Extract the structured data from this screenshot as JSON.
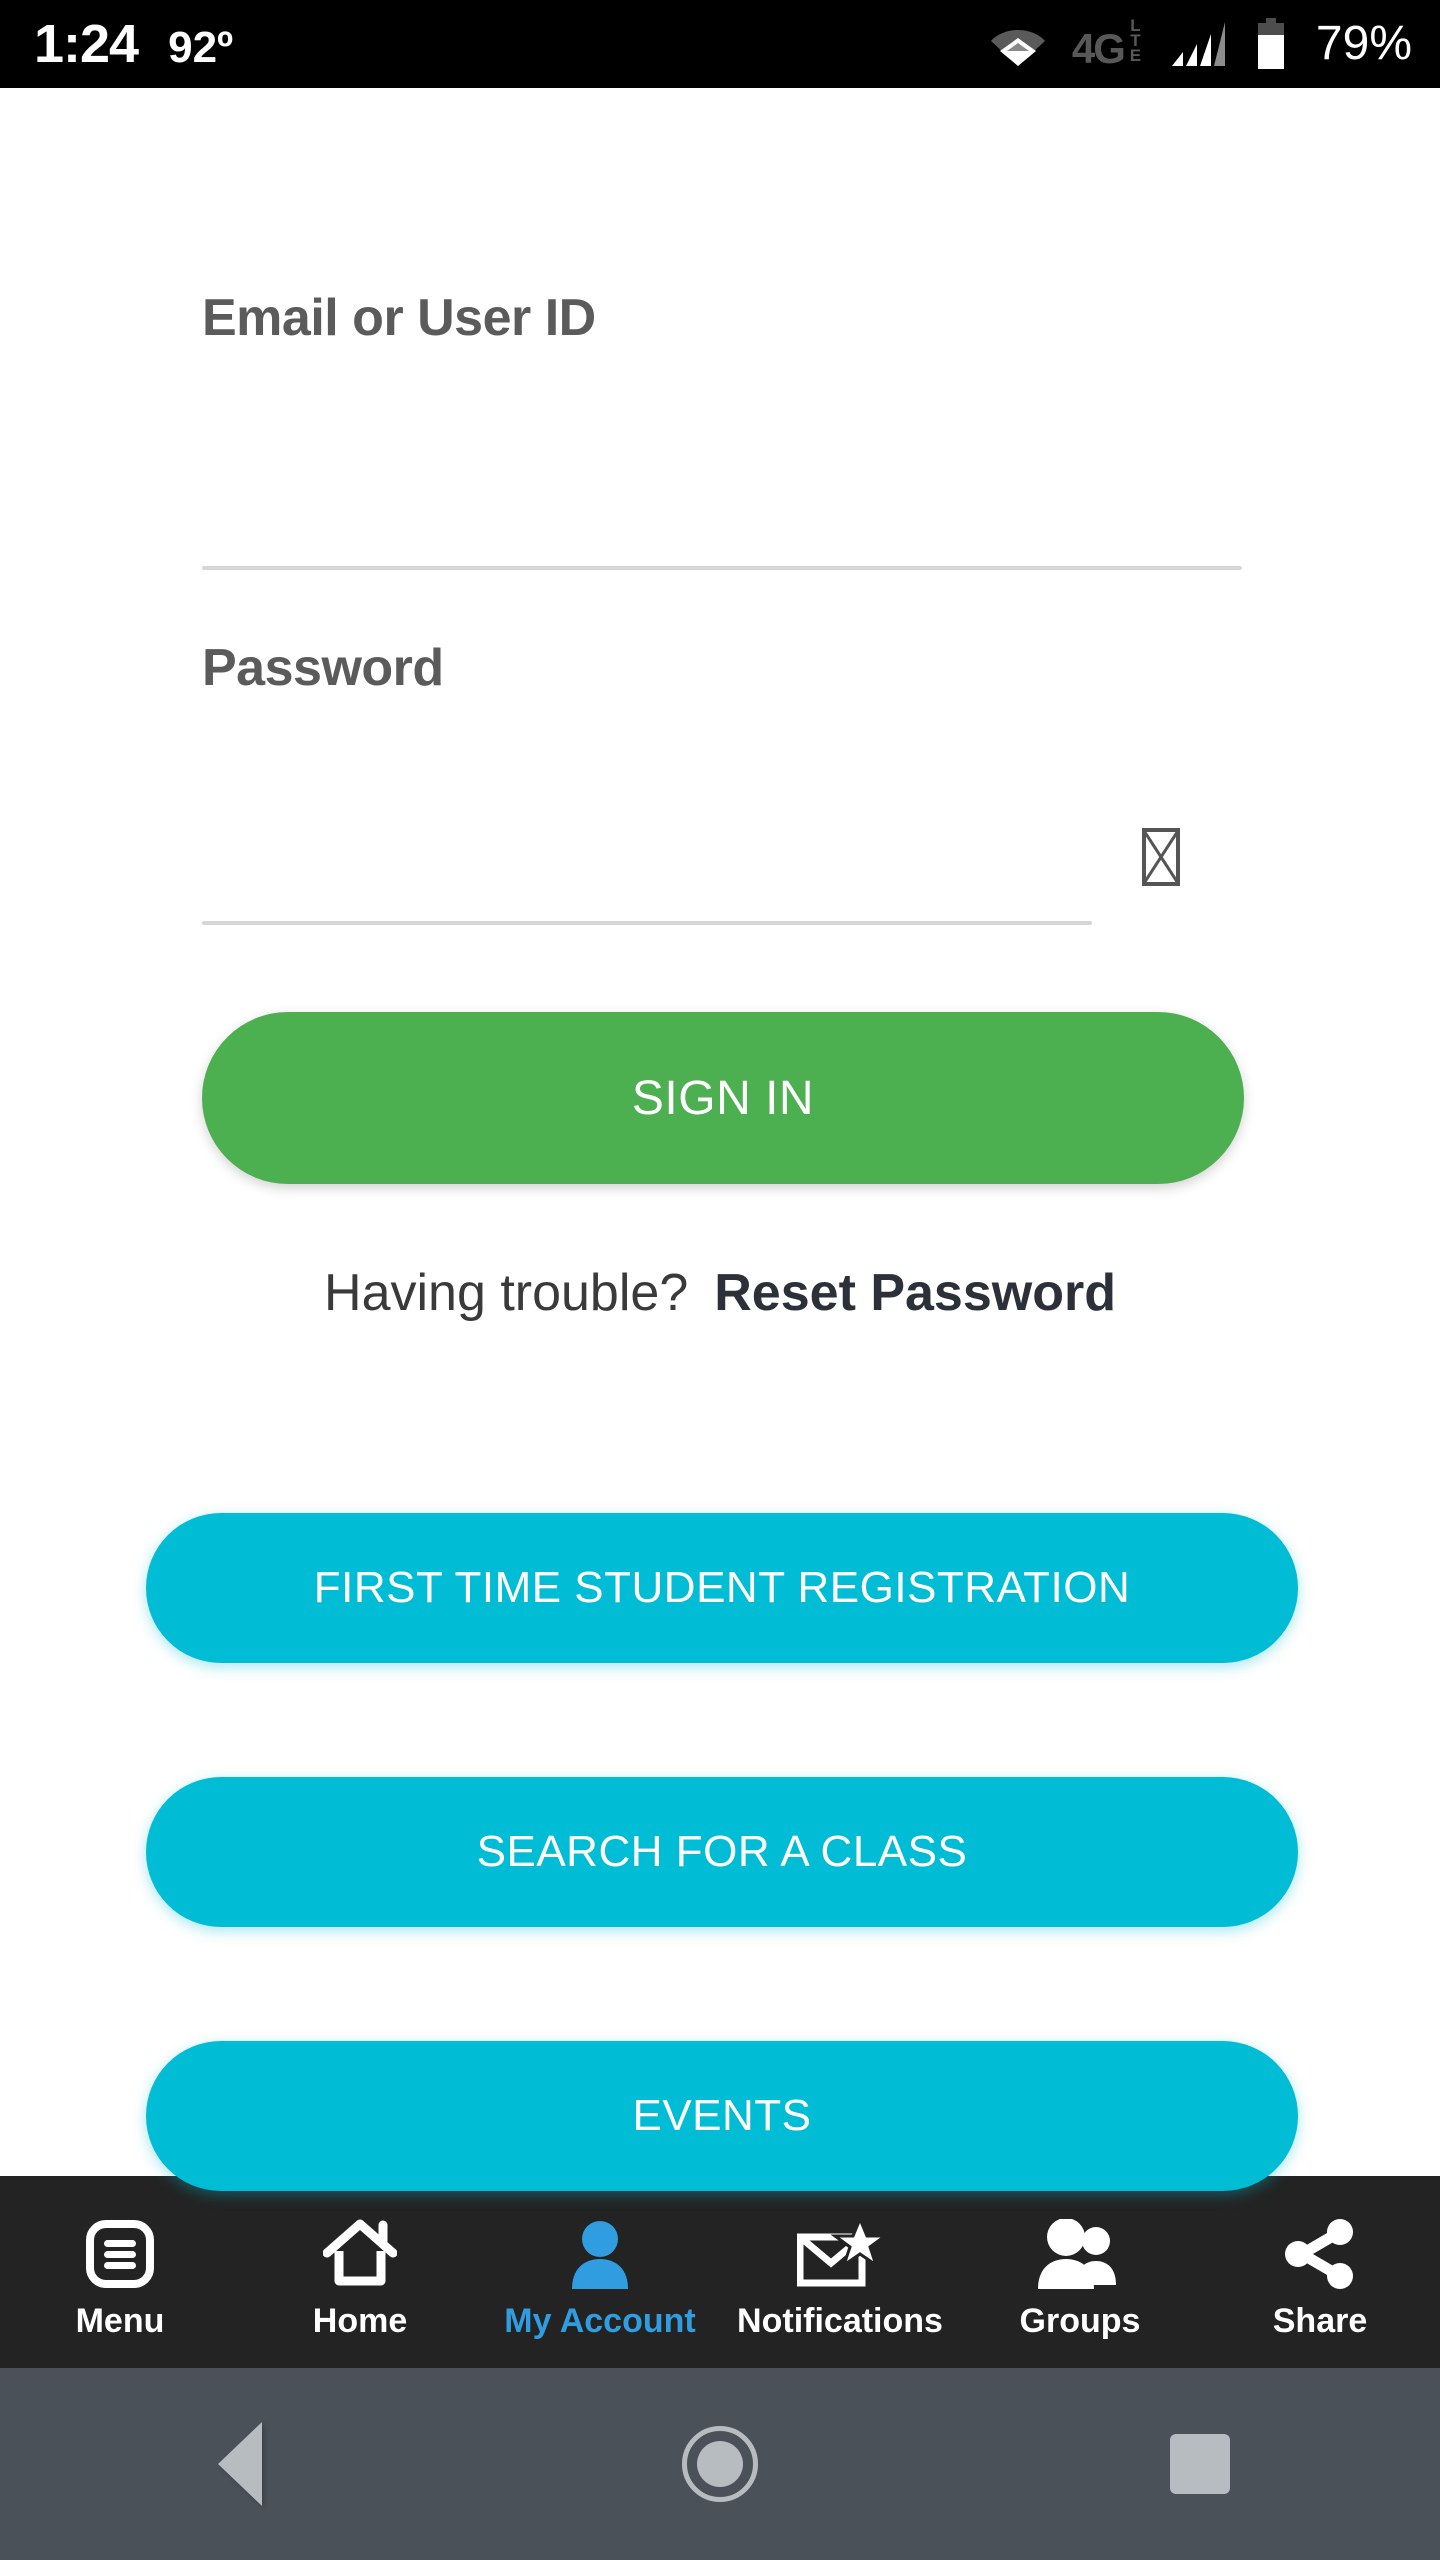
{
  "status_bar": {
    "time": "1:24",
    "temperature": "92º",
    "network_type": "4G",
    "network_sub": "LTE",
    "battery_percent": "79%",
    "wifi_icon": "wifi-icon",
    "signal_icon": "cellular-signal-icon",
    "battery_icon": "battery-icon"
  },
  "login_form": {
    "email_label": "Email or User ID",
    "email_value": "",
    "email_placeholder": "",
    "password_label": "Password",
    "password_value": "",
    "password_placeholder": "",
    "password_toggle_icon": "missing-glyph-box",
    "sign_in_label": "SIGN IN",
    "sign_in_color": "#4CAF50",
    "trouble_text": "Having trouble?",
    "reset_password_label": "Reset Password"
  },
  "actions": {
    "accent_color": "#00BCD4",
    "buttons": [
      {
        "label": "FIRST TIME STUDENT REGISTRATION",
        "name": "first-time-student-registration-button"
      },
      {
        "label": "SEARCH FOR A CLASS",
        "name": "search-for-a-class-button"
      },
      {
        "label": "EVENTS",
        "name": "events-button"
      }
    ]
  },
  "tabbar": {
    "active_color": "#2F9DE0",
    "background": "#232323",
    "items": [
      {
        "label": "Menu",
        "icon": "menu-list-icon",
        "active": false
      },
      {
        "label": "Home",
        "icon": "home-icon",
        "active": false
      },
      {
        "label": "My Account",
        "icon": "person-account-icon",
        "active": true
      },
      {
        "label": "Notifications",
        "icon": "envelope-star-icon",
        "active": false
      },
      {
        "label": "Groups",
        "icon": "two-people-icon",
        "active": false
      },
      {
        "label": "Share",
        "icon": "share-nodes-icon",
        "active": false
      }
    ]
  },
  "android_nav": {
    "background": "#4A5158",
    "back_icon": "back-triangle-icon",
    "home_icon": "home-circle-icon",
    "recents_icon": "recents-square-icon"
  }
}
